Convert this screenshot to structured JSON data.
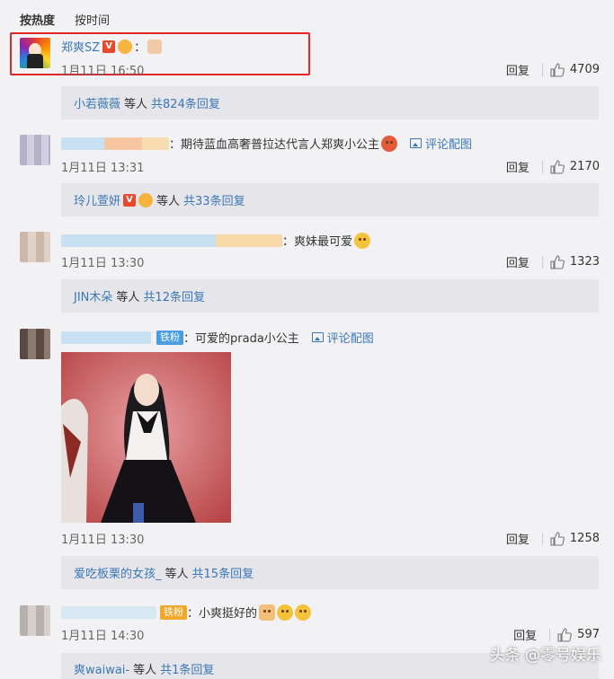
{
  "sort": {
    "hot": "按热度",
    "time": "按时间"
  },
  "comments": [
    {
      "name": "郑爽SZ",
      "text": "",
      "time": "1月11日 16:50",
      "reply": "回复",
      "likes": "4709",
      "sub": {
        "name": "小若薇薇",
        "mid": "等人",
        "more": "共824条回复"
      }
    },
    {
      "name": "",
      "text": "：期待蓝血高奢普拉达代言人郑爽小公主",
      "pic_link": "评论配图",
      "time": "1月11日 13:31",
      "reply": "回复",
      "likes": "2170",
      "sub": {
        "name": "玲儿萱妍",
        "mid": "等人",
        "more": "共33条回复"
      }
    },
    {
      "name": "",
      "text": "：爽妹最可爱",
      "time": "1月11日 13:30",
      "reply": "回复",
      "likes": "1323",
      "sub": {
        "name": "JIN木朵",
        "mid": "等人",
        "more": "共12条回复"
      }
    },
    {
      "name": "",
      "tag": "铁粉",
      "text": "：可爱的prada小公主",
      "pic_link": "评论配图",
      "time": "1月11日 13:30",
      "reply": "回复",
      "likes": "1258",
      "sub": {
        "name": "爱吃板栗的女孩_",
        "mid": "等人",
        "more": "共15条回复"
      }
    },
    {
      "name": "",
      "tag": "铁粉",
      "text": "：小爽挺好的",
      "time": "1月11日 14:30",
      "reply": "回复",
      "likes": "597",
      "sub": {
        "name": "爽waiwai-",
        "mid": "等人",
        "more": "共1条回复"
      }
    }
  ],
  "watermark": "头条 @零号娱乐",
  "colors": {
    "link": "#3a77b6",
    "highlight": "#e2262a",
    "background": "#f2f2f5"
  }
}
